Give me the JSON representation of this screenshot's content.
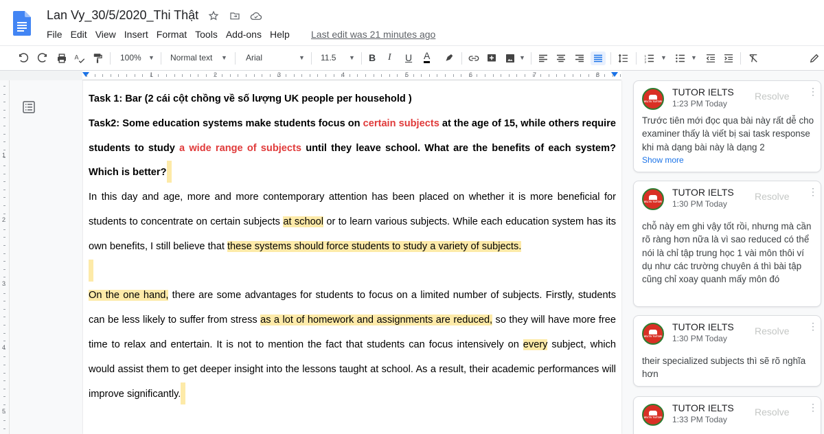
{
  "doc_title": "Lan Vy_30/5/2020_Thi Thật",
  "menu": [
    "File",
    "Edit",
    "View",
    "Insert",
    "Format",
    "Tools",
    "Add-ons",
    "Help"
  ],
  "last_edit": "Last edit was 21 minutes ago",
  "toolbar": {
    "zoom": "100%",
    "style": "Normal text",
    "font": "Arial",
    "size": "11.5",
    "bold": "B",
    "italic": "I",
    "underline": "U",
    "text_color": "A"
  },
  "ruler_numbers": [
    "1",
    "2",
    "3",
    "4",
    "5",
    "6",
    "7",
    "8"
  ],
  "vruler_numbers": [
    "1",
    "2",
    "3",
    "4",
    "5"
  ],
  "document": {
    "task1": "Task 1: Bar (2 cái cột chồng về số lượng UK people per household )",
    "task2_part1": "Task2: Some education systems make students focus on ",
    "task2_red1": "certain subjects",
    "task2_part2": " at the age of 15, while others require students to study ",
    "task2_red2": "a wide range of subjects",
    "task2_part3": " until they leave school. What are the benefits of each system? Which is better?",
    "p1_a": "In this day and age, more and more contemporary attention has been placed on whether it is more beneficial for students to concentrate on certain subjects ",
    "p1_hl1": "at school",
    "p1_b": " or to learn various subjects. While each education system has its own benefits, I still believe that ",
    "p1_hl2": "these systems should force students to study a variety of subjects.",
    "p2_hl1": "On the one hand,",
    "p2_a": " there are some advantages for students to focus on a limited number of subjects. Firstly, students can be less likely to suffer from stress ",
    "p2_hl2": "as a lot of homework and assignments are reduced,",
    "p2_b": " so they will have more free time to relax and entertain. It is not to mention the fact that students can focus intensively on ",
    "p2_hl3": "every",
    "p2_c": " subject, which would assist them to get deeper insight into the lessons taught at school. As a result, their academic performances will improve significantly."
  },
  "comments": [
    {
      "author": "TUTOR IELTS",
      "time": "1:23 PM Today",
      "resolve": "Resolve",
      "body": "Trước tiên mới đọc qua bài này rất dễ cho examiner thấy là viết bị sai task response khi mà dạng bài này là dạng 2",
      "show_more": "Show more"
    },
    {
      "author": "TUTOR IELTS",
      "time": "1:30 PM Today",
      "resolve": "Resolve",
      "body": "chỗ này em ghi vậy tốt rồi, nhưng mà cần rõ ràng hơn nữa là vì sao reduced có thể nói là chỉ tập trung học 1 vài môn thôi ví dụ như các trường chuyên á thì bài tập cũng chỉ xoay quanh mấy môn đó"
    },
    {
      "author": "TUTOR IELTS",
      "time": "1:30 PM Today",
      "resolve": "Resolve",
      "body": "their specialized subjects thì sẽ rõ nghĩa hơn"
    },
    {
      "author": "TUTOR IELTS",
      "time": "1:33 PM Today",
      "resolve": "Resolve"
    }
  ],
  "avatar_text": "IELTS TUTOR",
  "colors": {
    "highlight": "#fdeaa8",
    "red_text": "#e03a3a",
    "link": "#1a73e8",
    "docs_blue": "#4285f4"
  }
}
